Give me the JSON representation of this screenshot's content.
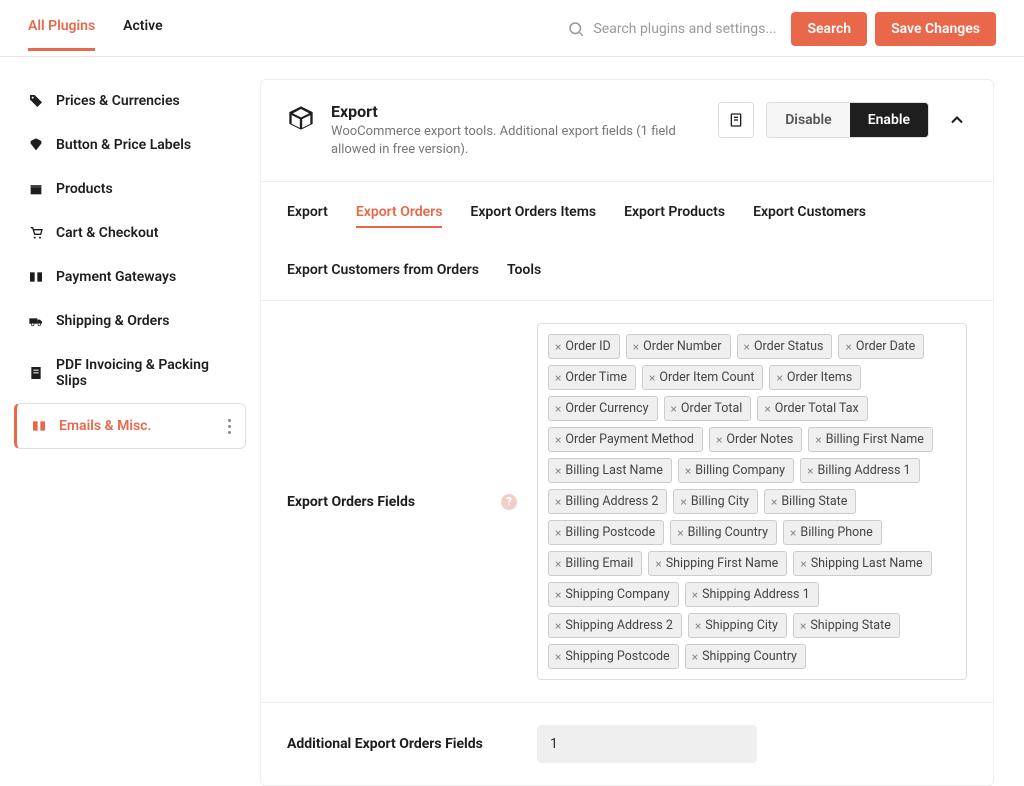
{
  "top": {
    "tabs": [
      "All Plugins",
      "Active"
    ],
    "active_tab": 0,
    "search_placeholder": "Search plugins and settings...",
    "search_label": "Search",
    "save_label": "Save Changes"
  },
  "sidebar": {
    "items": [
      {
        "label": "Prices & Currencies",
        "icon": "tag"
      },
      {
        "label": "Button & Price Labels",
        "icon": "label"
      },
      {
        "label": "Products",
        "icon": "box"
      },
      {
        "label": "Cart & Checkout",
        "icon": "cart"
      },
      {
        "label": "Payment Gateways",
        "icon": "gateway"
      },
      {
        "label": "Shipping & Orders",
        "icon": "truck"
      },
      {
        "label": "PDF Invoicing & Packing Slips",
        "icon": "pdf"
      },
      {
        "label": "Emails & Misc.",
        "icon": "mail"
      }
    ],
    "selected": 7
  },
  "module": {
    "title": "Export",
    "description": "WooCommerce export tools. Additional export fields (1 field allowed in free version).",
    "disable_label": "Disable",
    "enable_label": "Enable",
    "subtabs": [
      "Export",
      "Export Orders",
      "Export Orders Items",
      "Export Products",
      "Export Customers",
      "Export Customers from Orders",
      "Tools"
    ],
    "active_subtab": 1,
    "fields_label": "Export Orders Fields",
    "chips": [
      "Order ID",
      "Order Number",
      "Order Status",
      "Order Date",
      "Order Time",
      "Order Item Count",
      "Order Items",
      "Order Currency",
      "Order Total",
      "Order Total Tax",
      "Order Payment Method",
      "Order Notes",
      "Billing First Name",
      "Billing Last Name",
      "Billing Company",
      "Billing Address 1",
      "Billing Address 2",
      "Billing City",
      "Billing State",
      "Billing Postcode",
      "Billing Country",
      "Billing Phone",
      "Billing Email",
      "Shipping First Name",
      "Shipping Last Name",
      "Shipping Company",
      "Shipping Address 1",
      "Shipping Address 2",
      "Shipping City",
      "Shipping State",
      "Shipping Postcode",
      "Shipping Country"
    ],
    "additional_label": "Additional Export Orders Fields",
    "additional_value": "1"
  }
}
